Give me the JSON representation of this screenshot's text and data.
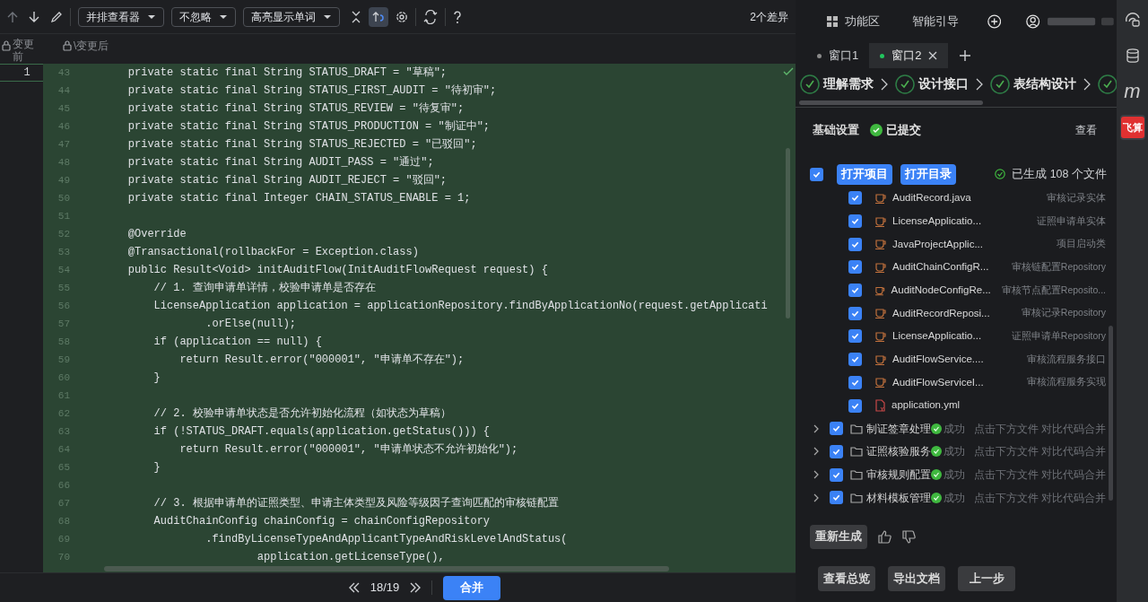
{
  "toolbar": {
    "viewer_dropdown": "并排查看器",
    "ignore_dropdown": "不忽略",
    "highlight_dropdown": "高亮显示单词",
    "sync_scroll_on": true,
    "diff_count": "2个差异"
  },
  "editor": {
    "left_label": "变更前",
    "right_label": "\\变更后",
    "old_line_numbers": [
      "1"
    ],
    "lines": [
      {
        "number": "43",
        "text": "    private static final String STATUS_DRAFT = \"草稿\";"
      },
      {
        "number": "44",
        "text": "    private static final String STATUS_FIRST_AUDIT = \"待初审\";"
      },
      {
        "number": "45",
        "text": "    private static final String STATUS_REVIEW = \"待复审\";"
      },
      {
        "number": "46",
        "text": "    private static final String STATUS_PRODUCTION = \"制证中\";"
      },
      {
        "number": "47",
        "text": "    private static final String STATUS_REJECTED = \"已驳回\";"
      },
      {
        "number": "48",
        "text": "    private static final String AUDIT_PASS = \"通过\";"
      },
      {
        "number": "49",
        "text": "    private static final String AUDIT_REJECT = \"驳回\";"
      },
      {
        "number": "50",
        "text": "    private static final Integer CHAIN_STATUS_ENABLE = 1;"
      },
      {
        "number": "51"
      },
      {
        "number": "52",
        "text": "    @Override"
      },
      {
        "number": "53",
        "text": "    @Transactional(rollbackFor = Exception.class)"
      },
      {
        "number": "54",
        "text": "    public Result<Void> initAuditFlow(InitAuditFlowRequest request) {"
      },
      {
        "number": "55",
        "text": "        // 1. 查询申请单详情，校验申请单是否存在"
      },
      {
        "number": "56",
        "text": "        LicenseApplication application = applicationRepository.findByApplicationNo(request.getApplicati"
      },
      {
        "number": "57",
        "text": "                .orElse(null);"
      },
      {
        "number": "58",
        "text": "        if (application == null) {"
      },
      {
        "number": "59",
        "text": "            return Result.error(\"000001\", \"申请单不存在\");"
      },
      {
        "number": "60",
        "text": "        }"
      },
      {
        "number": "61"
      },
      {
        "number": "62",
        "text": "        // 2. 校验申请单状态是否允许初始化流程（如状态为草稿）"
      },
      {
        "number": "63",
        "text": "        if (!STATUS_DRAFT.equals(application.getStatus())) {"
      },
      {
        "number": "64",
        "text": "            return Result.error(\"000001\", \"申请单状态不允许初始化\");"
      },
      {
        "number": "65",
        "text": "        }"
      },
      {
        "number": "66"
      },
      {
        "number": "67",
        "text": "        // 3. 根据申请单的证照类型、申请主体类型及风险等级因子查询匹配的审核链配置"
      },
      {
        "number": "68",
        "text": "        AuditChainConfig chainConfig = chainConfigRepository"
      },
      {
        "number": "69",
        "text": "                .findByLicenseTypeAndApplicantTypeAndRiskLevelAndStatus("
      },
      {
        "number": "70",
        "text": "                        application.getLicenseType(),"
      }
    ]
  },
  "navigator": {
    "counter": "18/19",
    "merge_button": "合并"
  },
  "panel_header": {
    "workspace": "功能区",
    "guide": "智能引导"
  },
  "tabs": [
    {
      "label": "窗口1",
      "selected": false
    },
    {
      "label": "窗口2",
      "selected": true
    }
  ],
  "steps": [
    {
      "label": "理解需求",
      "done": true
    },
    {
      "label": "设计接口",
      "done": true
    },
    {
      "label": "表结构设计",
      "done": true
    },
    {
      "done": true
    }
  ],
  "section": {
    "title": "基础设置",
    "status": "已提交",
    "view_link": "查看"
  },
  "project": {
    "checked": true,
    "buttons": [
      "打开项目",
      "打开目录"
    ],
    "summary": "已生成 108 个文件"
  },
  "files": [
    {
      "kind": "java",
      "name": "AuditRecord.java",
      "desc": "审核记录实体",
      "checked": true
    },
    {
      "kind": "java",
      "name": "LicenseApplicatio...",
      "desc": "证照申请单实体",
      "checked": true
    },
    {
      "kind": "java",
      "name": "JavaProjectApplic...",
      "desc": "项目启动类",
      "checked": true
    },
    {
      "kind": "java",
      "name": "AuditChainConfigR...",
      "desc": "审核链配置Repository",
      "checked": true
    },
    {
      "kind": "java",
      "name": "AuditNodeConfigRe...",
      "desc": "审核节点配置Reposito...",
      "checked": true
    },
    {
      "kind": "java",
      "name": "AuditRecordReposi...",
      "desc": "审核记录Repository",
      "checked": true
    },
    {
      "kind": "java",
      "name": "LicenseApplicatio...",
      "desc": "证照申请单Repository",
      "checked": true
    },
    {
      "kind": "java",
      "name": "AuditFlowService....",
      "desc": "审核流程服务接口",
      "checked": true
    },
    {
      "kind": "java",
      "name": "AuditFlowServiceI...",
      "desc": "审核流程服务实现",
      "checked": true
    },
    {
      "kind": "yml",
      "name": "application.yml",
      "checked": true
    }
  ],
  "modules": [
    {
      "name": "制证签章处理",
      "status": "成功",
      "hint": "点击下方文件 对比代码合并",
      "checked": true,
      "expanded": false
    },
    {
      "name": "证照核验服务",
      "status": "成功",
      "hint": "点击下方文件 对比代码合并",
      "checked": true,
      "expanded": false
    },
    {
      "name": "审核规则配置",
      "status": "成功",
      "hint": "点击下方文件 对比代码合并",
      "checked": true,
      "expanded": false
    },
    {
      "name": "材料模板管理",
      "status": "成功",
      "hint": "点击下方文件 对比代码合并",
      "checked": true,
      "expanded": false
    }
  ],
  "feedback": {
    "regenerate_button": "重新生成"
  },
  "bottom_buttons": [
    "查看总览",
    "导出文档",
    "上一步"
  ],
  "side_strip": [
    {
      "kind": "chat",
      "selected": false
    },
    {
      "kind": "database",
      "selected": false
    },
    {
      "kind": "letter",
      "label": "m",
      "selected": false
    },
    {
      "kind": "logo",
      "label": "飞算",
      "selected": true
    }
  ]
}
